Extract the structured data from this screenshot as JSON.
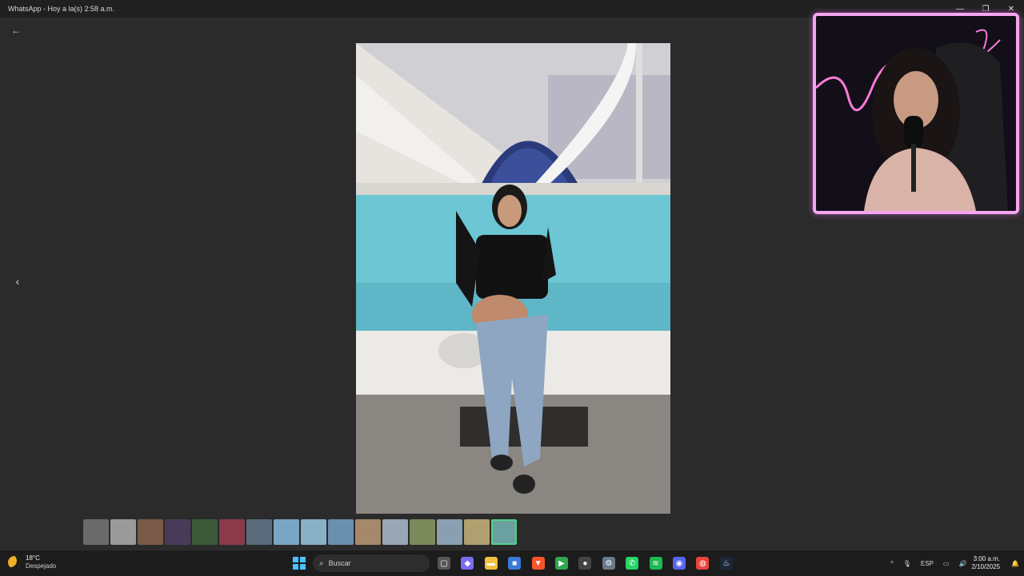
{
  "window": {
    "title": "WhatsApp - Hoy a la(s) 2:58 a.m.",
    "minimize_icon": "—",
    "maximize_icon": "❐",
    "close_icon": "✕"
  },
  "viewer": {
    "back_icon": "←",
    "prev_icon": "‹"
  },
  "thumbnails": [
    {
      "color": "#6a6a6a"
    },
    {
      "color": "#9a9a9a"
    },
    {
      "color": "#7a5a48"
    },
    {
      "color": "#4a3a5a"
    },
    {
      "color": "#3d5a3a"
    },
    {
      "color": "#8a3a4a"
    },
    {
      "color": "#5a6a7a"
    },
    {
      "color": "#7aa6c6"
    },
    {
      "color": "#8ab0c8"
    },
    {
      "color": "#6a90b0"
    },
    {
      "color": "#a8886a"
    },
    {
      "color": "#9aa6b6"
    },
    {
      "color": "#7a8a5a"
    },
    {
      "color": "#8aa0b0"
    },
    {
      "color": "#b0a070"
    },
    {
      "color": "#6aa0a0"
    }
  ],
  "taskbar": {
    "weather_temp": "18°C",
    "weather_desc": "Despejado",
    "search_placeholder": "Buscar",
    "search_icon": "⌕",
    "language": "ESP",
    "time": "3:00 a.m.",
    "date": "2/10/2025",
    "chevron_icon": "^",
    "mic_icon": "🎙",
    "network_icon": "▭",
    "volume_icon": "🔊",
    "notification_icon": "🔔"
  },
  "app_icons": [
    {
      "name": "task-view",
      "color": "#555555",
      "glyph": "▢"
    },
    {
      "name": "copilot",
      "color": "#7a6ef0",
      "glyph": "◆"
    },
    {
      "name": "file-explorer",
      "color": "#f0c040",
      "glyph": "▬"
    },
    {
      "name": "microsoft-store",
      "color": "#3a7ad8",
      "glyph": "■"
    },
    {
      "name": "brave",
      "color": "#fb542b",
      "glyph": "▼"
    },
    {
      "name": "media-player",
      "color": "#2fa84f",
      "glyph": "▶"
    },
    {
      "name": "obs",
      "color": "#444444",
      "glyph": "●"
    },
    {
      "name": "settings",
      "color": "#6a7a8a",
      "glyph": "⚙"
    },
    {
      "name": "whatsapp",
      "color": "#25d366",
      "glyph": "✆"
    },
    {
      "name": "spotify",
      "color": "#1db954",
      "glyph": "≋"
    },
    {
      "name": "discord",
      "color": "#5865f2",
      "glyph": "◉"
    },
    {
      "name": "chrome",
      "color": "#e8453c",
      "glyph": "◍"
    },
    {
      "name": "steam",
      "color": "#1b2838",
      "glyph": "♨"
    }
  ]
}
